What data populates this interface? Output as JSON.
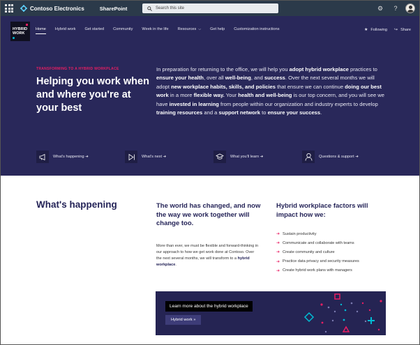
{
  "suite_bar": {
    "brand": "Contoso Electronics",
    "app_name": "SharePoint",
    "search_placeholder": "Search this site",
    "icons": [
      "waffle-icon",
      "settings-icon",
      "help-icon",
      "avatar"
    ]
  },
  "site": {
    "logo_text": [
      "HYBRID",
      "WORK"
    ],
    "nav": [
      {
        "label": "Home",
        "active": true
      },
      {
        "label": "Hybrid work"
      },
      {
        "label": "Get started"
      },
      {
        "label": "Community"
      },
      {
        "label": "Week in the life"
      },
      {
        "label": "Resources",
        "has_dropdown": true
      },
      {
        "label": "Get help"
      },
      {
        "label": "Customization instructions"
      }
    ],
    "actions": {
      "following": "Following",
      "share": "Share"
    }
  },
  "hero": {
    "eyebrow": "TRANSFORMING TO A HYBRID WORKPLACE",
    "title": "Helping you work when and where you're at your best",
    "body_segments": [
      {
        "t": "In preparation for returning to the office, we will help you "
      },
      {
        "t": "adopt hybrid workplace",
        "b": true
      },
      {
        "t": " practices to "
      },
      {
        "t": "ensure your health",
        "b": true
      },
      {
        "t": ", over all "
      },
      {
        "t": "well-being",
        "b": true
      },
      {
        "t": ", and "
      },
      {
        "t": "success",
        "b": true
      },
      {
        "t": ". Over the next several months we will adopt "
      },
      {
        "t": "new workplace habits, skills, and policies",
        "b": true
      },
      {
        "t": " that ensure we can continue "
      },
      {
        "t": "doing our best work",
        "b": true
      },
      {
        "t": " in a more "
      },
      {
        "t": "flexible way.",
        "b": true
      },
      {
        "t": " Your "
      },
      {
        "t": "health and well-being",
        "b": true
      },
      {
        "t": " is our top concern, and you will see we have "
      },
      {
        "t": "invested in learning",
        "b": true
      },
      {
        "t": " from people within our organization and industry experts to develop "
      },
      {
        "t": "training resources",
        "b": true
      },
      {
        "t": " and a "
      },
      {
        "t": "support network",
        "b": true
      },
      {
        "t": " to "
      },
      {
        "t": "ensure your success",
        "b": true
      },
      {
        "t": "."
      }
    ],
    "quick_links": [
      {
        "label": "What's happening ➜",
        "icon": "megaphone-icon"
      },
      {
        "label": "What's next ➜",
        "icon": "next-icon"
      },
      {
        "label": "What you'll learn ➜",
        "icon": "graduation-cap-icon"
      },
      {
        "label": "Questions & support ➜",
        "icon": "person-support-icon"
      }
    ]
  },
  "whats_happening": {
    "title": "What's happening",
    "changed_heading": "The world has changed, and now the way we work together will change too.",
    "changed_body_prefix": "More than ever, we must be flexible and forward-thinking in our approach to how we get work done at Contoso. Over the next several months, we will transform to a ",
    "changed_body_bold": "hybrid workplace",
    "changed_body_suffix": ".",
    "factors_heading": "Hybrid workplace factors will impact how we:",
    "factors": [
      "Sustain productivity",
      "Communicate and collaborate with teams",
      "Create community and culture",
      "Practice data privacy and security measures",
      "Create hybrid work plans with managers"
    ]
  },
  "banner": {
    "title": "Learn more about the hybrid workplace",
    "button": "Hybrid work »"
  },
  "colors": {
    "suite_bar": "#2b3a4a",
    "hero_bg": "#29285a",
    "accent_pink": "#e91e63",
    "accent_teal": "#00bcd4",
    "heading_navy": "#252458"
  }
}
